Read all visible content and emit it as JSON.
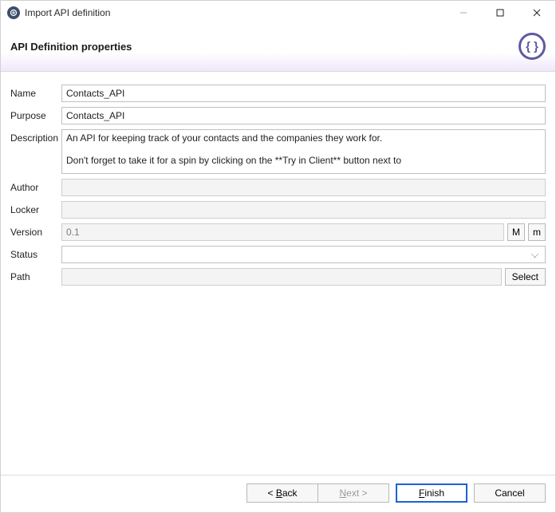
{
  "window": {
    "title": "Import API definition"
  },
  "header": {
    "title": "API Definition properties",
    "icon_glyph": "{ }"
  },
  "labels": {
    "name": "Name",
    "purpose": "Purpose",
    "description": "Description",
    "author": "Author",
    "locker": "Locker",
    "version": "Version",
    "status": "Status",
    "path": "Path"
  },
  "values": {
    "name": "Contacts_API",
    "purpose": "Contacts_API",
    "description": "An API for keeping track of your contacts and the companies they work for.\n\nDon't forget to take it for a spin by clicking on the **Try in Client** button next to",
    "author": "",
    "locker": "",
    "version": "0.1",
    "status": "",
    "path": ""
  },
  "buttons": {
    "major": "M",
    "minor": "m",
    "select": "Select",
    "back_prefix": "< ",
    "back_u": "B",
    "back_rest": "ack",
    "next_prefix": "",
    "next_u": "N",
    "next_rest": "ext >",
    "finish_prefix": "",
    "finish_u": "F",
    "finish_rest": "inish",
    "cancel": "Cancel"
  }
}
